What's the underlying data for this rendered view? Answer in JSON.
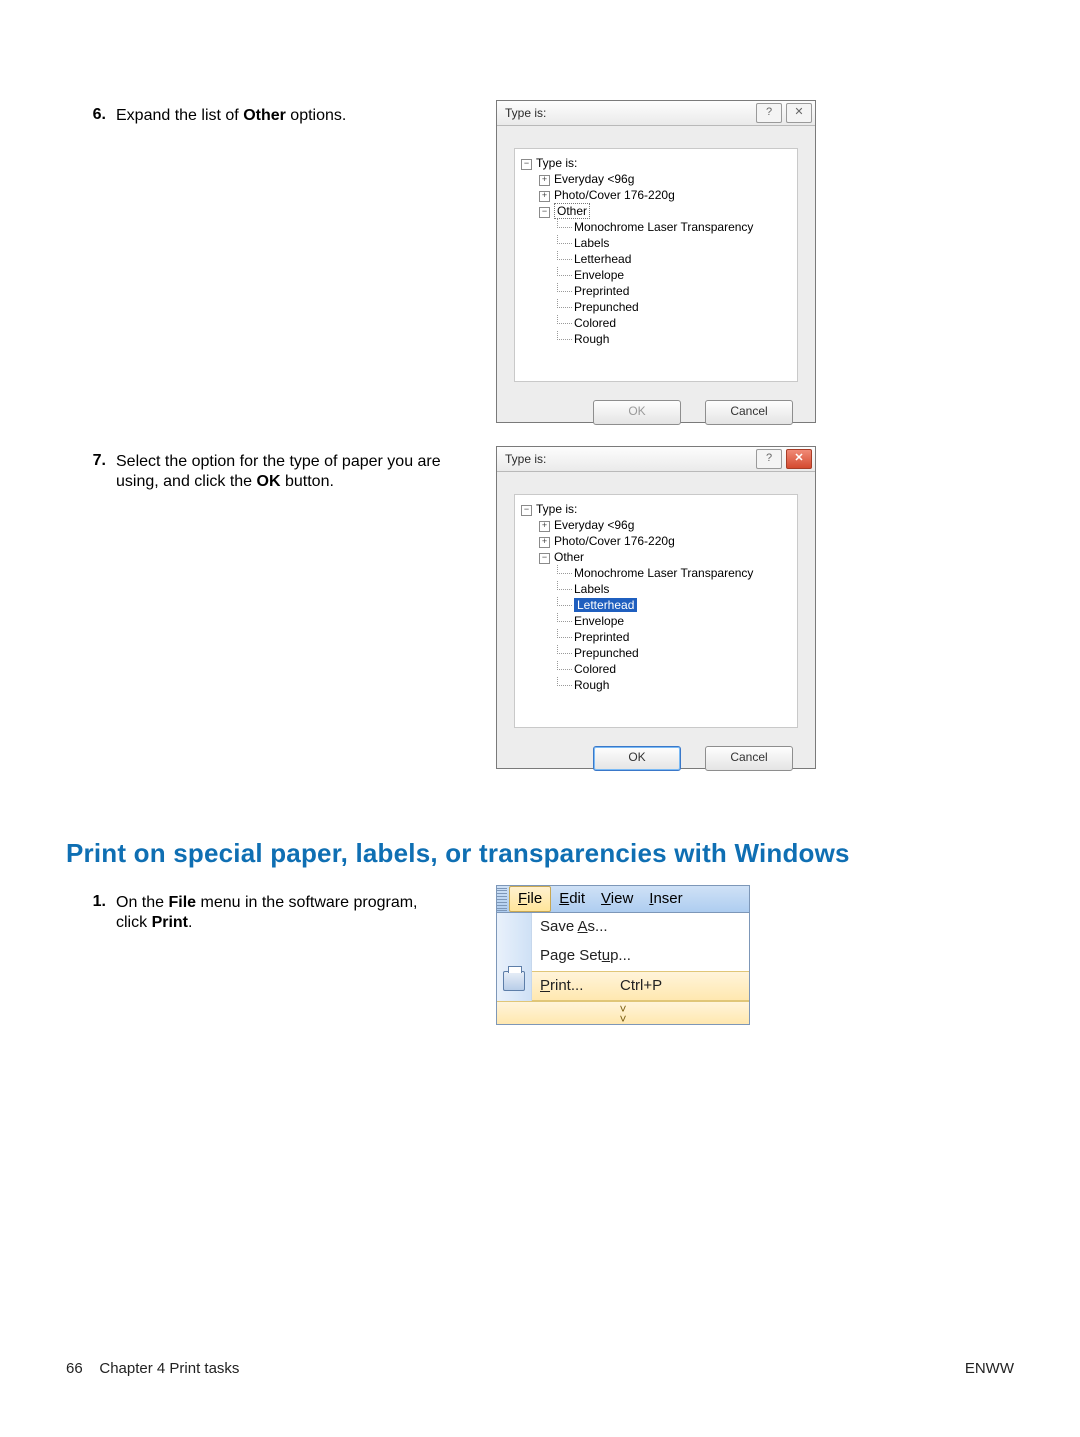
{
  "step6": {
    "num": "6.",
    "text_before": "Expand the list of ",
    "text_bold": "Other",
    "text_after": " options."
  },
  "step7": {
    "num": "7.",
    "line1_before": "Select the option for the type of paper you are",
    "line2_before": "using, and click the ",
    "line2_bold": "OK",
    "line2_after": " button."
  },
  "dialog1": {
    "title": "Type is:",
    "help_glyph": "?",
    "close_glyph": "✕",
    "tree_root": "Type is:",
    "everyday": "Everyday <96g",
    "photocover": "Photo/Cover 176-220g",
    "other": "Other",
    "items": {
      "mono": "Monochrome Laser Transparency",
      "labels": "Labels",
      "letterhead": "Letterhead",
      "envelope": "Envelope",
      "preprinted": "Preprinted",
      "prepunched": "Prepunched",
      "colored": "Colored",
      "rough": "Rough"
    },
    "ok": "OK",
    "cancel": "Cancel"
  },
  "dialog2": {
    "title": "Type is:",
    "help_glyph": "?",
    "close_glyph": "✕",
    "tree_root": "Type is:",
    "everyday": "Everyday <96g",
    "photocover": "Photo/Cover 176-220g",
    "other": "Other",
    "items": {
      "mono": "Monochrome Laser Transparency",
      "labels": "Labels",
      "letterhead": "Letterhead",
      "envelope": "Envelope",
      "preprinted": "Preprinted",
      "prepunched": "Prepunched",
      "colored": "Colored",
      "rough": "Rough"
    },
    "ok": "OK",
    "cancel": "Cancel"
  },
  "heading": "Print on special paper, labels, or transparencies with Windows",
  "step1": {
    "num": "1.",
    "l1_before": "On the ",
    "l1_bold": "File",
    "l1_after": " menu in the software program,",
    "l2_before": "click ",
    "l2_bold": "Print",
    "l2_after": "."
  },
  "filemenu": {
    "menubar": {
      "file": "File",
      "edit": "Edit",
      "view": "View",
      "inser": "Inser"
    },
    "save_as": "Save As...",
    "page_setup": "Page Setup...",
    "print": "Print...",
    "print_shortcut": "Ctrl+P",
    "chevrons": "˅\n˅"
  },
  "footer": {
    "page_num": "66",
    "chapter": "Chapter 4   Print tasks",
    "brand": "ENWW"
  }
}
